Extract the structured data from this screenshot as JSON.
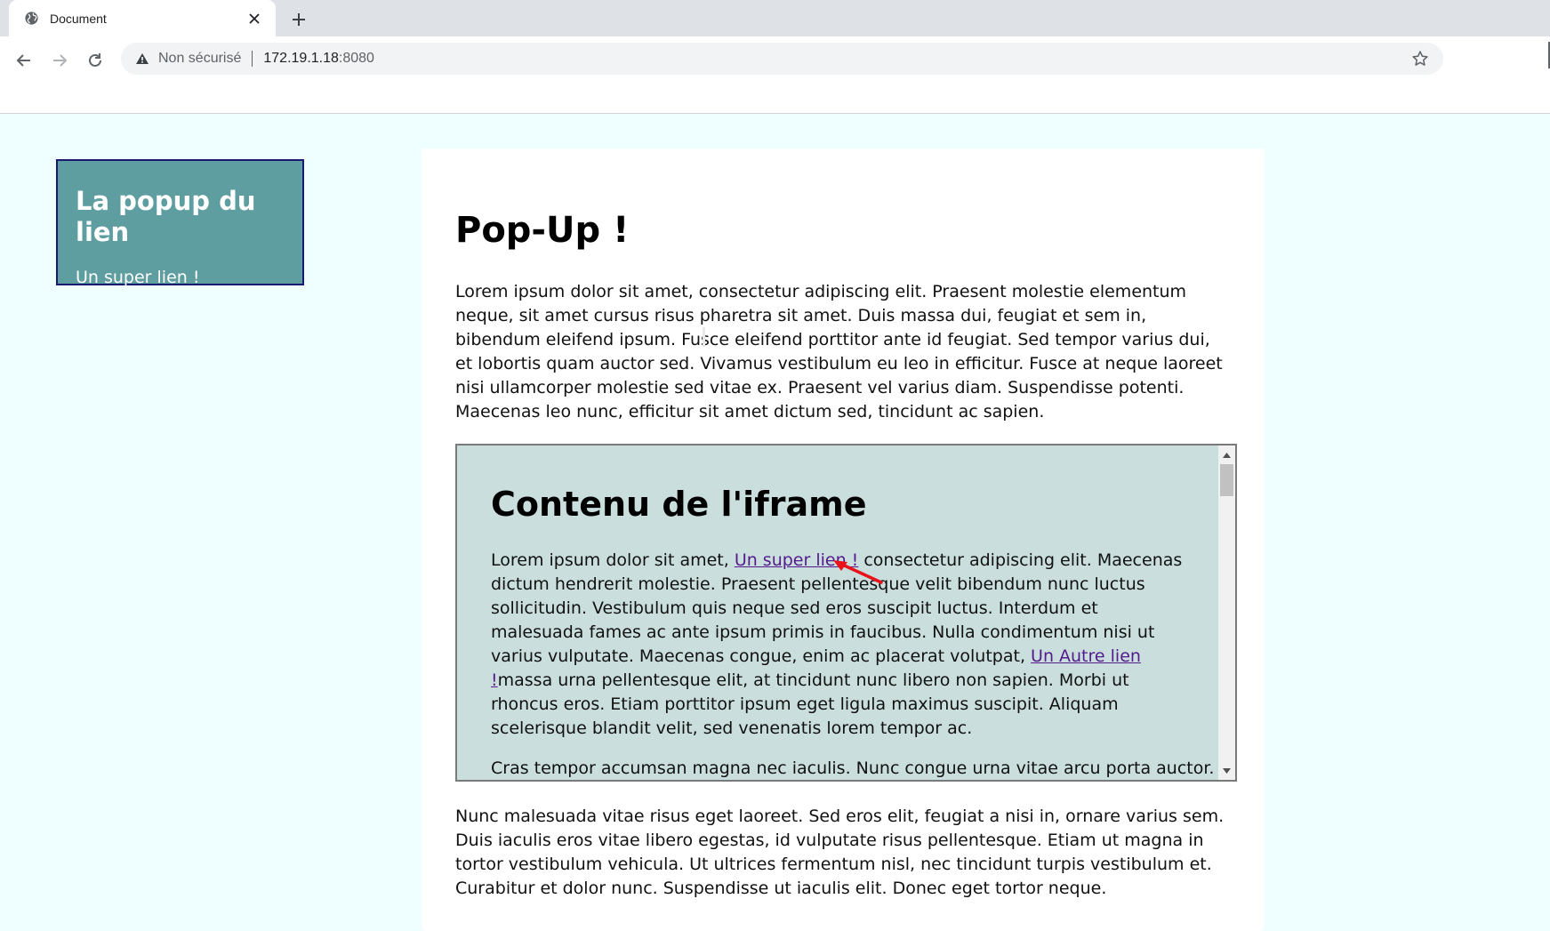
{
  "browser": {
    "tab_title": "Document",
    "tab_icon": "globe-icon",
    "security_label": "Non sécurisé",
    "url_host": "172.19.1.18",
    "url_port": ":8080"
  },
  "popup": {
    "title": "La popup du lien",
    "link_text": "Un super lien !",
    "bg_color": "#5f9ea0",
    "border_color": "#191970"
  },
  "page": {
    "title": "Pop-Up !",
    "para1": "Lorem ipsum dolor sit amet, consectetur adipiscing elit. Praesent molestie elementum neque, sit amet cursus risus pharetra sit amet. Duis massa dui, feugiat et sem in, bibendum eleifend ipsum. Fusce eleifend porttitor ante id feugiat. Sed tempor varius dui, et lobortis quam auctor sed. Vivamus vestibulum eu leo in efficitur. Fusce at neque laoreet nisi ullamcorper molestie sed vitae ex. Praesent vel varius diam. Suspendisse potenti. Maecenas leo nunc, efficitur sit amet dictum sed, tincidunt ac sapien.",
    "para3": "Nunc malesuada vitae risus eget laoreet. Sed eros elit, feugiat a nisi in, ornare varius sem. Duis iaculis eros vitae libero egestas, id vulputate risus pellentesque. Etiam ut magna in tortor vestibulum vehicula. Ut ultrices fermentum nisl, nec tincidunt turpis vestibulum et. Curabitur et dolor nunc. Suspendisse ut iaculis elit. Donec eget tortor neque."
  },
  "iframe": {
    "title": "Contenu de l'iframe",
    "p1_before": "Lorem ipsum dolor sit amet, ",
    "link1": "Un super lien !",
    "p1_middle": " consectetur adipiscing elit. Maecenas dictum hendrerit molestie. Praesent pellentesque velit bibendum nunc luctus sollicitudin. Vestibulum quis neque sed eros suscipit luctus. Interdum et malesuada fames ac ante ipsum primis in faucibus. Nulla condimentum nisi ut varius vulputate. Maecenas congue, enim ac placerat volutpat, ",
    "link2": "Un Autre lien !",
    "p1_after": "massa urna pellentesque elit, at tincidunt nunc libero non sapien. Morbi ut rhoncus eros. Etiam porttitor ipsum eget ligula maximus suscipit. Aliquam scelerisque blandit velit, sed venenatis lorem tempor ac.",
    "p2": "Cras tempor accumsan magna nec iaculis. Nunc congue urna vitae arcu porta auctor. Ut",
    "bg_color": "#c9dedd",
    "link_color": "#551a8b"
  },
  "annotation": {
    "arrow_color": "#e8141a"
  }
}
